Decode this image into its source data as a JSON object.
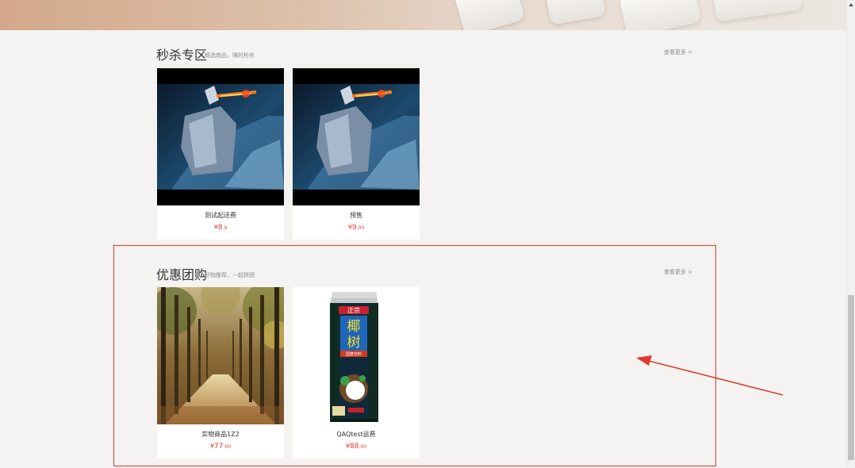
{
  "seckill": {
    "title": "秒杀专区",
    "subtitle": "精选商品，限时秒杀",
    "more": "查看更多 >",
    "products": [
      {
        "name": "测试起送费",
        "currency": "¥",
        "price_int": "8",
        "price_dec": ".9"
      },
      {
        "name": "预售",
        "currency": "¥",
        "price_int": "9",
        "price_dec": ".00"
      }
    ]
  },
  "group_buy": {
    "title": "优惠团购",
    "subtitle": "好物推荐，一起拼团",
    "more": "查看更多 >",
    "products": [
      {
        "name": "实物商品1Z2",
        "currency": "¥",
        "price_int": "77",
        "price_dec": ".00"
      },
      {
        "name": "QAQtest运费",
        "currency": "¥",
        "price_int": "88",
        "price_dec": ".00"
      }
    ]
  },
  "can_label": {
    "brand": "椰树",
    "top": "正宗",
    "badge": "国宴饮料"
  },
  "colors": {
    "price": "#e4393c",
    "annotation": "#e03a2f"
  }
}
